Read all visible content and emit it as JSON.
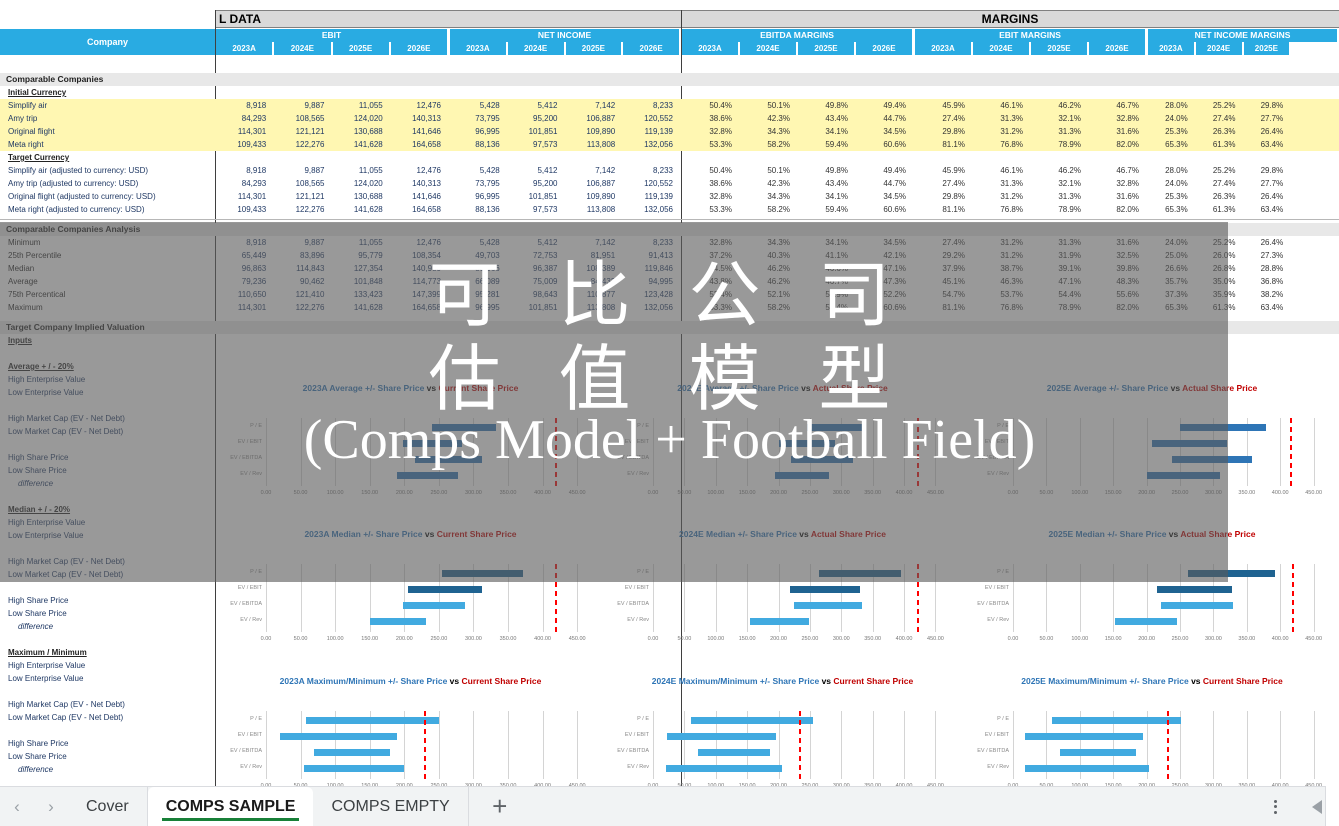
{
  "app": {
    "name": "spreadsheet"
  },
  "bands": [
    {
      "label": "L DATA",
      "align": "left"
    },
    {
      "label": "MARGINS",
      "align": "center"
    }
  ],
  "header": {
    "company_label": "Company",
    "groups": [
      "EBIT",
      "NET INCOME",
      "EBITDA MARGINS",
      "EBIT MARGINS",
      "NET INCOME MARGINS"
    ],
    "years": [
      "2023A",
      "2024E",
      "2025E",
      "2026E"
    ]
  },
  "sections": {
    "comparable_companies": "Comparable Companies",
    "initial_currency": "Initial Currency",
    "target_currency": "Target Currency",
    "comparable_companies_analysis": "Comparable Companies Analysis",
    "target_company_implied_valuation": "Target Company Implied Valuation",
    "inputs": "Inputs"
  },
  "companies_initial": [
    {
      "name": "Simplify air",
      "ebit": [
        "8,918",
        "9,887",
        "11,055",
        "12,476"
      ],
      "net_income": [
        "5,428",
        "5,412",
        "7,142",
        "8,233"
      ],
      "ebitda_margins": [
        "50.4%",
        "50.1%",
        "49.8%",
        "49.4%"
      ],
      "ebit_margins": [
        "45.9%",
        "46.1%",
        "46.2%",
        "46.7%"
      ],
      "net_income_margins": [
        "28.0%",
        "25.2%",
        "29.8%"
      ]
    },
    {
      "name": "Amy trip",
      "ebit": [
        "84,293",
        "108,565",
        "124,020",
        "140,313"
      ],
      "net_income": [
        "73,795",
        "95,200",
        "106,887",
        "120,552"
      ],
      "ebitda_margins": [
        "38.6%",
        "42.3%",
        "43.4%",
        "44.7%"
      ],
      "ebit_margins": [
        "27.4%",
        "31.3%",
        "32.1%",
        "32.8%"
      ],
      "net_income_margins": [
        "24.0%",
        "27.4%",
        "27.7%"
      ]
    },
    {
      "name": "Original flight",
      "ebit": [
        "114,301",
        "121,121",
        "130,688",
        "141,646"
      ],
      "net_income": [
        "96,995",
        "101,851",
        "109,890",
        "119,139"
      ],
      "ebitda_margins": [
        "32.8%",
        "34.3%",
        "34.1%",
        "34.5%"
      ],
      "ebit_margins": [
        "29.8%",
        "31.2%",
        "31.3%",
        "31.6%"
      ],
      "net_income_margins": [
        "25.3%",
        "26.3%",
        "26.4%"
      ]
    },
    {
      "name": "Meta right",
      "ebit": [
        "109,433",
        "122,276",
        "141,628",
        "164,658"
      ],
      "net_income": [
        "88,136",
        "97,573",
        "113,808",
        "132,056"
      ],
      "ebitda_margins": [
        "53.3%",
        "58.2%",
        "59.4%",
        "60.6%"
      ],
      "ebit_margins": [
        "81.1%",
        "76.8%",
        "78.9%",
        "82.0%"
      ],
      "net_income_margins": [
        "65.3%",
        "61.3%",
        "63.4%"
      ]
    }
  ],
  "companies_target": [
    {
      "name": "Simplify air (adjusted to currency: USD)",
      "ebit": [
        "8,918",
        "9,887",
        "11,055",
        "12,476"
      ],
      "net_income": [
        "5,428",
        "5,412",
        "7,142",
        "8,233"
      ],
      "ebitda_margins": [
        "50.4%",
        "50.1%",
        "49.8%",
        "49.4%"
      ],
      "ebit_margins": [
        "45.9%",
        "46.1%",
        "46.2%",
        "46.7%"
      ],
      "net_income_margins": [
        "28.0%",
        "25.2%",
        "29.8%"
      ]
    },
    {
      "name": "Amy trip (adjusted to currency: USD)",
      "ebit": [
        "84,293",
        "108,565",
        "124,020",
        "140,313"
      ],
      "net_income": [
        "73,795",
        "95,200",
        "106,887",
        "120,552"
      ],
      "ebitda_margins": [
        "38.6%",
        "42.3%",
        "43.4%",
        "44.7%"
      ],
      "ebit_margins": [
        "27.4%",
        "31.3%",
        "32.1%",
        "32.8%"
      ],
      "net_income_margins": [
        "24.0%",
        "27.4%",
        "27.7%"
      ]
    },
    {
      "name": "Original flight (adjusted to currency: USD)",
      "ebit": [
        "114,301",
        "121,121",
        "130,688",
        "141,646"
      ],
      "net_income": [
        "96,995",
        "101,851",
        "109,890",
        "119,139"
      ],
      "ebitda_margins": [
        "32.8%",
        "34.3%",
        "34.1%",
        "34.5%"
      ],
      "ebit_margins": [
        "29.8%",
        "31.2%",
        "31.3%",
        "31.6%"
      ],
      "net_income_margins": [
        "25.3%",
        "26.3%",
        "26.4%"
      ]
    },
    {
      "name": "Meta right (adjusted to currency: USD)",
      "ebit": [
        "109,433",
        "122,276",
        "141,628",
        "164,658"
      ],
      "net_income": [
        "88,136",
        "97,573",
        "113,808",
        "132,056"
      ],
      "ebitda_margins": [
        "53.3%",
        "58.2%",
        "59.4%",
        "60.6%"
      ],
      "ebit_margins": [
        "81.1%",
        "76.8%",
        "78.9%",
        "82.0%"
      ],
      "net_income_margins": [
        "65.3%",
        "61.3%",
        "63.4%"
      ]
    }
  ],
  "analysis": [
    {
      "name": "Minimum",
      "ebit": [
        "8,918",
        "9,887",
        "11,055",
        "12,476"
      ],
      "net_income": [
        "5,428",
        "5,412",
        "7,142",
        "8,233"
      ],
      "ebitda_margins": [
        "32.8%",
        "34.3%",
        "34.1%",
        "34.5%"
      ],
      "ebit_margins": [
        "27.4%",
        "31.2%",
        "31.3%",
        "31.6%"
      ],
      "net_income_margins": [
        "24.0%",
        "25.2%",
        "26.4%"
      ]
    },
    {
      "name": "25th Percentile",
      "ebit": [
        "65,449",
        "83,896",
        "95,779",
        "108,354"
      ],
      "net_income": [
        "49,703",
        "72,753",
        "81,951",
        "91,413"
      ],
      "ebitda_margins": [
        "37.2%",
        "40.3%",
        "41.1%",
        "42.1%"
      ],
      "ebit_margins": [
        "29.2%",
        "31.2%",
        "31.9%",
        "32.5%"
      ],
      "net_income_margins": [
        "25.0%",
        "26.0%",
        "27.3%"
      ]
    },
    {
      "name": "Median",
      "ebit": [
        "96,863",
        "114,843",
        "127,354",
        "140,980"
      ],
      "net_income": [
        "80,966",
        "96,387",
        "108,389",
        "119,846"
      ],
      "ebitda_margins": [
        "44.5%",
        "46.2%",
        "46.6%",
        "47.1%"
      ],
      "ebit_margins": [
        "37.9%",
        "38.7%",
        "39.1%",
        "39.8%"
      ],
      "net_income_margins": [
        "26.6%",
        "26.8%",
        "28.8%"
      ]
    },
    {
      "name": "Average",
      "ebit": [
        "79,236",
        "90,462",
        "101,848",
        "114,773"
      ],
      "net_income": [
        "66,089",
        "75,009",
        "84,432",
        "94,995"
      ],
      "ebitda_margins": [
        "43.8%",
        "46.2%",
        "46.7%",
        "47.3%"
      ],
      "ebit_margins": [
        "45.1%",
        "46.3%",
        "47.1%",
        "48.3%"
      ],
      "net_income_margins": [
        "35.7%",
        "35.0%",
        "36.8%"
      ]
    },
    {
      "name": "75th Percentical",
      "ebit": [
        "110,650",
        "121,410",
        "133,423",
        "147,399"
      ],
      "net_income": [
        "95,281",
        "98,643",
        "110,877",
        "123,428"
      ],
      "ebitda_margins": [
        "52.4%",
        "52.1%",
        "52.9%",
        "52.2%"
      ],
      "ebit_margins": [
        "54.7%",
        "53.7%",
        "54.4%",
        "55.6%"
      ],
      "net_income_margins": [
        "37.3%",
        "35.9%",
        "38.2%"
      ]
    },
    {
      "name": "Maximum",
      "ebit": [
        "114,301",
        "122,276",
        "141,628",
        "164,658"
      ],
      "net_income": [
        "96,995",
        "101,851",
        "113,808",
        "132,056"
      ],
      "ebitda_margins": [
        "53.3%",
        "58.2%",
        "59.4%",
        "60.6%"
      ],
      "ebit_margins": [
        "81.1%",
        "76.8%",
        "78.9%",
        "82.0%"
      ],
      "net_income_margins": [
        "65.3%",
        "61.3%",
        "63.4%"
      ]
    }
  ],
  "valuation_blocks": [
    {
      "title": "Average + / -   20%",
      "rows": [
        "High Enterprise Value",
        "Low Enterprise Value",
        "",
        "High Market Cap (EV - Net Debt)",
        "Low Market Cap (EV - Net Debt)",
        "",
        "High Share Price",
        "Low Share Price",
        " difference"
      ]
    },
    {
      "title": "Median + / -   20%",
      "rows": [
        "High Enterprise Value",
        "Low Enterprise Value",
        "",
        "High Market Cap (EV - Net Debt)",
        "Low Market Cap (EV - Net Debt)",
        "",
        "High Share Price",
        "Low Share Price",
        " difference"
      ]
    },
    {
      "title": "Maximum / Minimum",
      "rows": [
        "High Enterprise Value",
        "Low Enterprise Value",
        "",
        "High Market Cap (EV - Net Debt)",
        "Low Market Cap (EV - Net Debt)",
        "",
        "High Share Price",
        "Low Share Price",
        " difference"
      ]
    }
  ],
  "chart_data": {
    "type": "bar",
    "common": {
      "categories": [
        "P / E",
        "EV / EBIT",
        "EV / EBITDA",
        "EV / Rev"
      ],
      "xlabel": "",
      "ylabel": "",
      "tick_labels": [
        "0.00",
        "50.00",
        "100.00",
        "150.00",
        "200.00",
        "250.00",
        "300.00",
        "350.00",
        "400.00",
        "450.00"
      ],
      "xlim": [
        0,
        470
      ],
      "grid": true,
      "legend": "none",
      "bar_color_dark": "#2E75B6",
      "bar_color_light": "#41AAE0",
      "marker_color": "#FF0000",
      "marker_label": "Current Share Price"
    },
    "charts": [
      {
        "id": "avg-2023a",
        "title_parts": [
          "2023A Average +/-  Share Price",
          " vs ",
          "Current Share Price"
        ],
        "row": 1,
        "col": 1,
        "ranges": [
          [
            240,
            332
          ],
          [
            198,
            283
          ],
          [
            215,
            313
          ],
          [
            190,
            277
          ]
        ],
        "marker": 418,
        "shade": "dark"
      },
      {
        "id": "avg-2024e",
        "title_parts": [
          "2024E Average +/-  Share Price",
          " vs ",
          "Actual Share Price"
        ],
        "row": 1,
        "col": 2,
        "ranges": [
          [
            245,
            340
          ],
          [
            200,
            290
          ],
          [
            220,
            318
          ],
          [
            195,
            280
          ]
        ],
        "marker": 420,
        "shade": "dark"
      },
      {
        "id": "avg-2025e",
        "title_parts": [
          "2025E Average +/-  Share Price",
          " vs ",
          "Actual Share Price"
        ],
        "row": 1,
        "col": 3,
        "ranges": [
          [
            250,
            378
          ],
          [
            208,
            320
          ],
          [
            238,
            358
          ],
          [
            200,
            310
          ]
        ],
        "marker": 415,
        "shade": "dark"
      },
      {
        "id": "med-2023a",
        "title_parts": [
          "2023A Median +/-  Share Price",
          " vs ",
          "Current Share Price"
        ],
        "row": 2,
        "col": 1,
        "ranges": [
          [
            255,
            372
          ],
          [
            205,
            312
          ],
          [
            198,
            288
          ],
          [
            150,
            232
          ]
        ],
        "marker": 418,
        "shade": "mixed"
      },
      {
        "id": "med-2024e",
        "title_parts": [
          "2024E Median +/-  Share Price",
          " vs ",
          "Actual Share Price"
        ],
        "row": 2,
        "col": 2,
        "ranges": [
          [
            265,
            395
          ],
          [
            218,
            330
          ],
          [
            225,
            333
          ],
          [
            155,
            248
          ]
        ],
        "marker": 420,
        "shade": "mixed"
      },
      {
        "id": "med-2025e",
        "title_parts": [
          "2025E Median +/-  Share Price",
          " vs ",
          "Actual Share Price"
        ],
        "row": 2,
        "col": 3,
        "ranges": [
          [
            262,
            392
          ],
          [
            215,
            328
          ],
          [
            222,
            330
          ],
          [
            152,
            245
          ]
        ],
        "marker": 418,
        "shade": "mixed"
      },
      {
        "id": "maxmin-2023a",
        "title_parts": [
          "2023A Maximum/Minimum +/-  Share Price",
          "vs ",
          "Current Share Price"
        ],
        "row": 3,
        "col": 1,
        "ranges": [
          [
            58,
            250
          ],
          [
            20,
            190
          ],
          [
            70,
            180
          ],
          [
            55,
            200
          ]
        ],
        "marker": 228,
        "shade": "light"
      },
      {
        "id": "maxmin-2024e",
        "title_parts": [
          "2024E Maximum/Minimum +/-  Share Price",
          "vs ",
          "Current Share Price"
        ],
        "row": 3,
        "col": 2,
        "ranges": [
          [
            60,
            255
          ],
          [
            22,
            196
          ],
          [
            72,
            186
          ],
          [
            20,
            206
          ]
        ],
        "marker": 232,
        "shade": "light"
      },
      {
        "id": "maxmin-2025e",
        "title_parts": [
          "2025E Maximum/Minimum +/-  Share Price",
          "vs ",
          "Current Share Price"
        ],
        "row": 3,
        "col": 3,
        "ranges": [
          [
            58,
            252
          ],
          [
            18,
            194
          ],
          [
            70,
            184
          ],
          [
            18,
            204
          ]
        ],
        "marker": 230,
        "shade": "light"
      }
    ]
  },
  "watermark": {
    "line1": "可 比 公 司",
    "line2": "估 值 模 型",
    "line3": "(Comps Model + Football Field)"
  },
  "tabbar": {
    "prev_icon": "chevron-left-icon",
    "next_icon": "chevron-right-icon",
    "tabs": [
      {
        "label": "Cover",
        "active": false
      },
      {
        "label": "COMPS SAMPLE",
        "active": true
      },
      {
        "label": "COMPS EMPTY",
        "active": false
      }
    ],
    "add_label": "+",
    "menu_icon": "kebab-menu-icon",
    "collapse_icon": "triangle-left-icon"
  }
}
